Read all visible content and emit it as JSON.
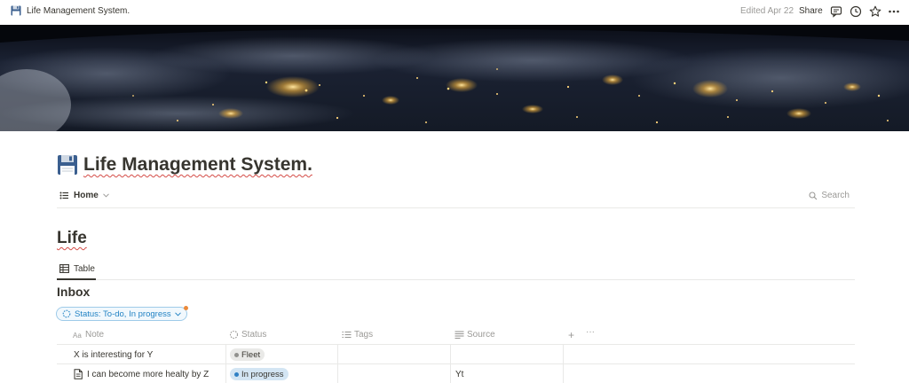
{
  "topbar": {
    "breadcrumb_title": "Life Management System.",
    "edited": "Edited Apr 22",
    "share_label": "Share",
    "icons": [
      "comment-icon",
      "clock-icon",
      "star-icon",
      "more-icon"
    ]
  },
  "page": {
    "icon": "floppy-disk-icon",
    "title": "Life Management System."
  },
  "home_view": {
    "label": "Home",
    "search_label": "Search"
  },
  "section": {
    "title": "Life"
  },
  "views": {
    "tab_label": "Table"
  },
  "inbox": {
    "title": "Inbox",
    "filter_label": "Status: To-do, In progress",
    "columns": [
      {
        "label": "Note",
        "icon": "title-aa-icon"
      },
      {
        "label": "Status",
        "icon": "status-icon"
      },
      {
        "label": "Tags",
        "icon": "list-icon"
      },
      {
        "label": "Source",
        "icon": "text-icon"
      }
    ],
    "rows": [
      {
        "note": "X is interesting for Y",
        "has_page_icon": false,
        "status": "Fleet",
        "status_color": "#91918e",
        "status_bg": "#e9e9e7",
        "tags": "",
        "source": ""
      },
      {
        "note": "I can become more healty by Z",
        "has_page_icon": true,
        "status": "In progress",
        "status_color": "#2f80c4",
        "status_bg": "#d3e5f3",
        "tags": "",
        "source": "Yt"
      }
    ]
  },
  "colors": {
    "text": "#37352f",
    "muted": "#9b9a97",
    "accent": "#2383c4",
    "spellcheck": "#d44c47"
  }
}
